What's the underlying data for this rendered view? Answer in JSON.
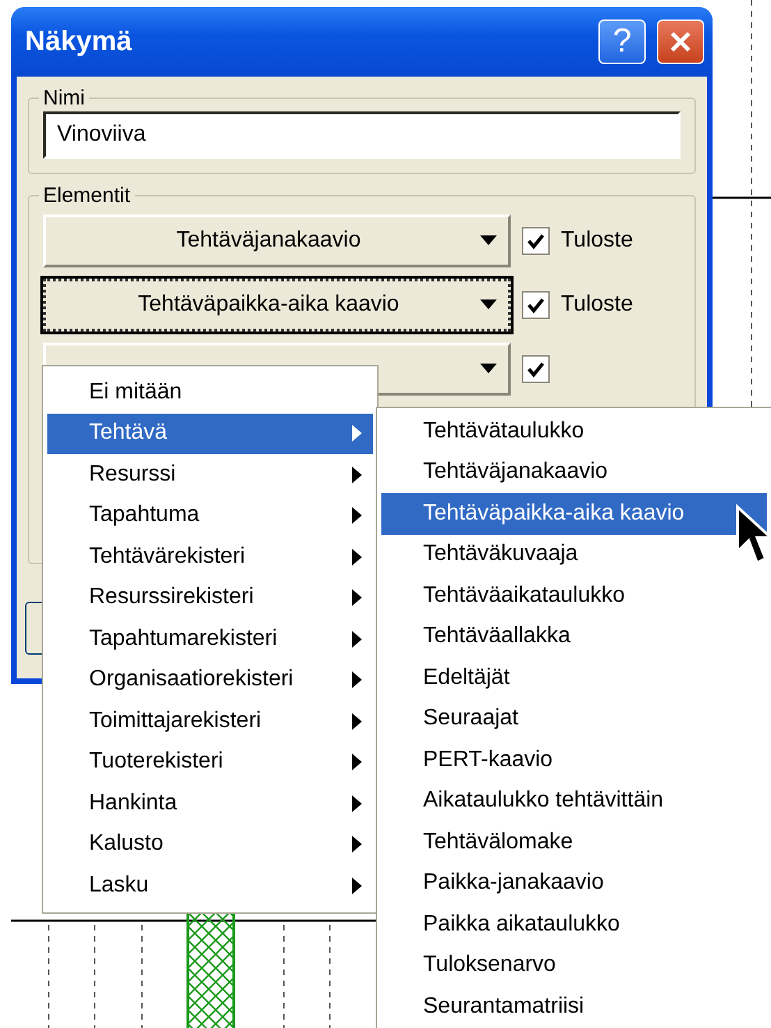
{
  "window": {
    "title": "Näkymä",
    "help_button": "?"
  },
  "name_group": {
    "label": "Nimi",
    "value": "Vinoviiva"
  },
  "elements_group": {
    "label": "Elementit",
    "rows": [
      {
        "value": "Tehtäväjanakaavio",
        "focused": false,
        "checked": true,
        "check_label": "Tuloste"
      },
      {
        "value": "Tehtäväpaikka-aika kaavio",
        "focused": true,
        "checked": true,
        "check_label": "Tuloste"
      },
      {
        "focused": false,
        "checked": true
      }
    ]
  },
  "menu": {
    "items": [
      {
        "label": "Ei mitään",
        "has_submenu": false,
        "selected": false
      },
      {
        "label": "Tehtävä",
        "has_submenu": true,
        "selected": true
      },
      {
        "label": "Resurssi",
        "has_submenu": true,
        "selected": false
      },
      {
        "label": "Tapahtuma",
        "has_submenu": true,
        "selected": false
      },
      {
        "label": "Tehtävärekisteri",
        "has_submenu": true,
        "selected": false
      },
      {
        "label": "Resurssirekisteri",
        "has_submenu": true,
        "selected": false
      },
      {
        "label": "Tapahtumarekisteri",
        "has_submenu": true,
        "selected": false
      },
      {
        "label": "Organisaatiorekisteri",
        "has_submenu": true,
        "selected": false
      },
      {
        "label": "Toimittajarekisteri",
        "has_submenu": true,
        "selected": false
      },
      {
        "label": "Tuoterekisteri",
        "has_submenu": true,
        "selected": false
      },
      {
        "label": "Hankinta",
        "has_submenu": true,
        "selected": false
      },
      {
        "label": "Kalusto",
        "has_submenu": true,
        "selected": false
      },
      {
        "label": "Lasku",
        "has_submenu": true,
        "selected": false
      }
    ]
  },
  "submenu": {
    "items": [
      {
        "label": "Tehtävätaulukko",
        "selected": false
      },
      {
        "label": "Tehtäväjanakaavio",
        "selected": false
      },
      {
        "label": "Tehtäväpaikka-aika kaavio",
        "selected": true
      },
      {
        "label": "Tehtäväkuvaaja",
        "selected": false
      },
      {
        "label": "Tehtäväaikataulukko",
        "selected": false
      },
      {
        "label": "Tehtäväallakka",
        "selected": false
      },
      {
        "label": "Edeltäjät",
        "selected": false
      },
      {
        "label": "Seuraajat",
        "selected": false
      },
      {
        "label": "PERT-kaavio",
        "selected": false
      },
      {
        "label": "Aikataulukko tehtävittäin",
        "selected": false
      },
      {
        "label": "Tehtävälomake",
        "selected": false
      },
      {
        "label": "Paikka-janakaavio",
        "selected": false
      },
      {
        "label": "Paikka aikataulukko",
        "selected": false
      },
      {
        "label": "Tuloksenarvo",
        "selected": false
      },
      {
        "label": "Seurantamatriisi",
        "selected": false
      }
    ]
  }
}
